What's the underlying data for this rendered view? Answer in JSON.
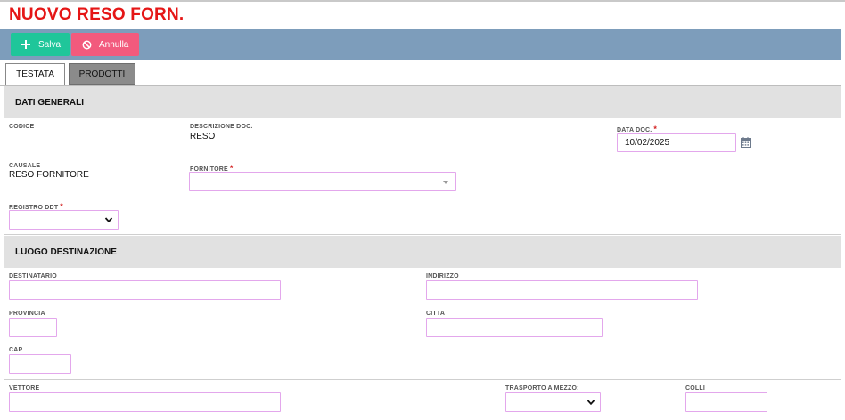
{
  "header": {
    "title": "NUOVO RESO FORN."
  },
  "toolbar": {
    "save_label": "Salva",
    "cancel_label": "Annulla"
  },
  "tabs": [
    {
      "label": "TESTATA"
    },
    {
      "label": "PRODOTTI"
    }
  ],
  "sections": {
    "dati_generali": {
      "title": "DATI GENERALI",
      "codice": {
        "label": "CODICE",
        "value": ""
      },
      "descrizione_doc": {
        "label": "DESCRIZIONE DOC.",
        "value": "RESO"
      },
      "data_doc": {
        "label": "DATA DOC.",
        "required_mark": "*",
        "value": "10/02/2025"
      },
      "causale": {
        "label": "CAUSALE",
        "value": "RESO FORNITORE"
      },
      "fornitore": {
        "label": "FORNITORE",
        "required_mark": "*",
        "value": ""
      },
      "registro_ddt": {
        "label": "REGISTRO DDT",
        "required_mark": "*",
        "value": ""
      }
    },
    "luogo_destinazione": {
      "title": "LUOGO DESTINAZIONE",
      "destinatario": {
        "label": "DESTINATARIO",
        "value": ""
      },
      "indirizzo": {
        "label": "INDIRIZZO",
        "value": ""
      },
      "provincia": {
        "label": "PROVINCIA",
        "value": ""
      },
      "citta": {
        "label": "CITTA",
        "value": ""
      },
      "cap": {
        "label": "CAP",
        "value": ""
      }
    },
    "trasporto": {
      "vettore": {
        "label": "VETTORE",
        "value": ""
      },
      "trasporto_a_mezzo": {
        "label": "TRASPORTO A MEZZO:",
        "value": ""
      },
      "colli": {
        "label": "COLLI",
        "value": ""
      }
    }
  },
  "colors": {
    "title": "#e51616",
    "toolbar": "#7d9dbb",
    "save": "#1fc69a",
    "cancel": "#f25a7d",
    "input_border": "#e3a7ec",
    "required": "#d32020"
  },
  "icons": {
    "save": "plus-icon",
    "cancel": "ban-icon",
    "date": "calendar-icon",
    "select": "chevron-down-icon"
  }
}
